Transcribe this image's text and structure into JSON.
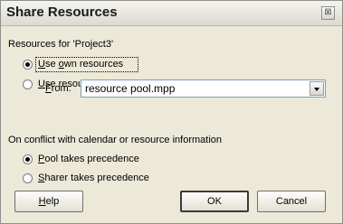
{
  "window": {
    "title": "Share Resources",
    "close_glyph": "⊠"
  },
  "resources_group": {
    "label": "Resources for 'Project3'",
    "options": [
      {
        "label": "Use own resources",
        "checked": true
      },
      {
        "label": "Use resources",
        "checked": false
      }
    ],
    "from_label": "From:",
    "from_value": "resource pool.mpp"
  },
  "conflict_group": {
    "label": "On conflict with calendar or resource information",
    "options": [
      {
        "label": "Pool takes precedence",
        "checked": true
      },
      {
        "label": "Sharer takes precedence",
        "checked": false
      }
    ]
  },
  "buttons": {
    "help": "Help",
    "ok": "OK",
    "cancel": "Cancel"
  }
}
